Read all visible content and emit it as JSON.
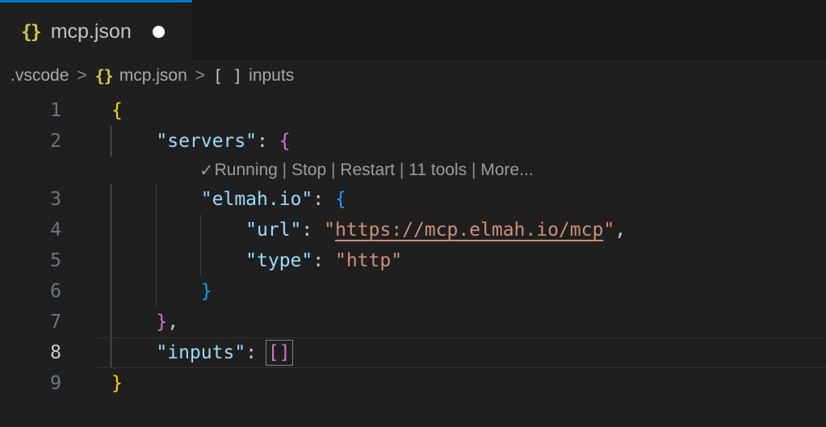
{
  "tab": {
    "icon": "{}",
    "label": "mcp.json",
    "modified": true
  },
  "breadcrumbs": [
    {
      "icon": "",
      "icon_name": "",
      "label": ".vscode"
    },
    {
      "icon": "{}",
      "icon_name": "json-file-icon",
      "label": "mcp.json"
    },
    {
      "icon": "[ ]",
      "icon_name": "array-symbol-icon",
      "label": "inputs"
    }
  ],
  "breadcrumb_separator": ">",
  "codelens": {
    "check": "✓",
    "items": [
      "Running",
      "Stop",
      "Restart",
      "11 tools",
      "More..."
    ],
    "separator": " | "
  },
  "editor": {
    "current_line": "8",
    "lines": [
      {
        "num": "1",
        "tokens": [
          {
            "t": "{",
            "s": "b1"
          }
        ]
      },
      {
        "num": "2",
        "tokens": [
          {
            "t": "    ",
            "s": "ws"
          },
          {
            "t": "\"servers\"",
            "s": "key"
          },
          {
            "t": ": ",
            "s": "punc"
          },
          {
            "t": "{",
            "s": "b2"
          }
        ]
      },
      {
        "codelens": true
      },
      {
        "num": "3",
        "tokens": [
          {
            "t": "        ",
            "s": "ws"
          },
          {
            "t": "\"elmah.io\"",
            "s": "key"
          },
          {
            "t": ": ",
            "s": "punc"
          },
          {
            "t": "{",
            "s": "b3"
          }
        ]
      },
      {
        "num": "4",
        "tokens": [
          {
            "t": "            ",
            "s": "ws"
          },
          {
            "t": "\"url\"",
            "s": "key"
          },
          {
            "t": ": ",
            "s": "punc"
          },
          {
            "t": "\"",
            "s": "str"
          },
          {
            "t": "https://mcp.elmah.io/mcp",
            "s": "url"
          },
          {
            "t": "\"",
            "s": "str"
          },
          {
            "t": ",",
            "s": "punc"
          }
        ]
      },
      {
        "num": "5",
        "tokens": [
          {
            "t": "            ",
            "s": "ws"
          },
          {
            "t": "\"type\"",
            "s": "key"
          },
          {
            "t": ": ",
            "s": "punc"
          },
          {
            "t": "\"http\"",
            "s": "str"
          }
        ]
      },
      {
        "num": "6",
        "tokens": [
          {
            "t": "        ",
            "s": "ws"
          },
          {
            "t": "}",
            "s": "b3"
          }
        ]
      },
      {
        "num": "7",
        "tokens": [
          {
            "t": "    ",
            "s": "ws"
          },
          {
            "t": "}",
            "s": "b2"
          },
          {
            "t": ",",
            "s": "punc"
          }
        ]
      },
      {
        "num": "8",
        "tokens": [
          {
            "t": "    ",
            "s": "ws"
          },
          {
            "t": "\"inputs\"",
            "s": "key"
          },
          {
            "t": ": ",
            "s": "punc"
          },
          {
            "t": "[]",
            "s": "b2 match"
          }
        ]
      },
      {
        "num": "9",
        "tokens": [
          {
            "t": "}",
            "s": "b1"
          }
        ]
      }
    ]
  },
  "colors": {
    "accent": "#0078d4",
    "editor_bg": "#1f1f1f",
    "tabbar_bg": "#181818",
    "key": "#9cdcfe",
    "string": "#ce9178",
    "bracket_level1": "#ffd700",
    "bracket_level2": "#da70d6",
    "bracket_level3": "#179fff",
    "codelens_fg": "#999999",
    "json_icon": "#cbcb41"
  }
}
